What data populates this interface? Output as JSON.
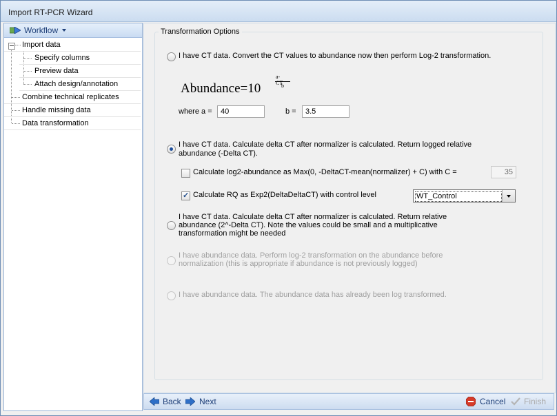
{
  "window": {
    "title": "Import RT-PCR Wizard"
  },
  "workflow": {
    "label": "Workflow",
    "items": [
      {
        "label": "Import data",
        "level": 0,
        "expanded": true
      },
      {
        "label": "Specify columns",
        "level": 1
      },
      {
        "label": "Preview data",
        "level": 1
      },
      {
        "label": "Attach design/annotation",
        "level": 1
      },
      {
        "label": "Combine technical replicates",
        "level": 0
      },
      {
        "label": "Handle missing data",
        "level": 0
      },
      {
        "label": "Data transformation",
        "level": 0
      }
    ]
  },
  "options": {
    "group_title": "Transformation Options",
    "opt1": {
      "label": "I have CT data. Convert the CT values to abundance now then perform Log-2 transformation.",
      "selected": false
    },
    "formula": {
      "base": "Abundance=10",
      "num": "a-CT",
      "den": "b"
    },
    "a_label": "where a =",
    "a_value": "40",
    "b_label": "b =",
    "b_value": "3.5",
    "opt2": {
      "line1": "I have CT data. Calculate delta CT after normalizer is calculated. Return logged relative",
      "line2": "abundance (-Delta CT).",
      "selected": true
    },
    "log2_check": {
      "label": "Calculate log2-abundance as Max(0, -DeltaCT-mean(normalizer) + C) with C =",
      "checked": false,
      "value": "35"
    },
    "rq_check": {
      "label": "Calculate RQ as Exp2(DeltaDeltaCT) with control level",
      "checked": true
    },
    "control_level": "WT_Control",
    "opt3": {
      "line1": "I have CT data. Calculate delta CT after normalizer is calculated. Return relative",
      "line2": "abundance (2^-Delta CT). Note the values could be small and a multiplicative",
      "line3": "transformation might be needed",
      "selected": false
    },
    "opt4": {
      "line1": "I have abundance data. Perform log-2 transformation on the abundance before",
      "line2": "normalization (this is appropriate if abundance is not previously logged)",
      "enabled": false
    },
    "opt5": {
      "label": "I have abundance data. The abundance data has already been log transformed.",
      "enabled": false
    }
  },
  "nav": {
    "back": "Back",
    "next": "Next",
    "cancel": "Cancel",
    "finish": "Finish"
  }
}
